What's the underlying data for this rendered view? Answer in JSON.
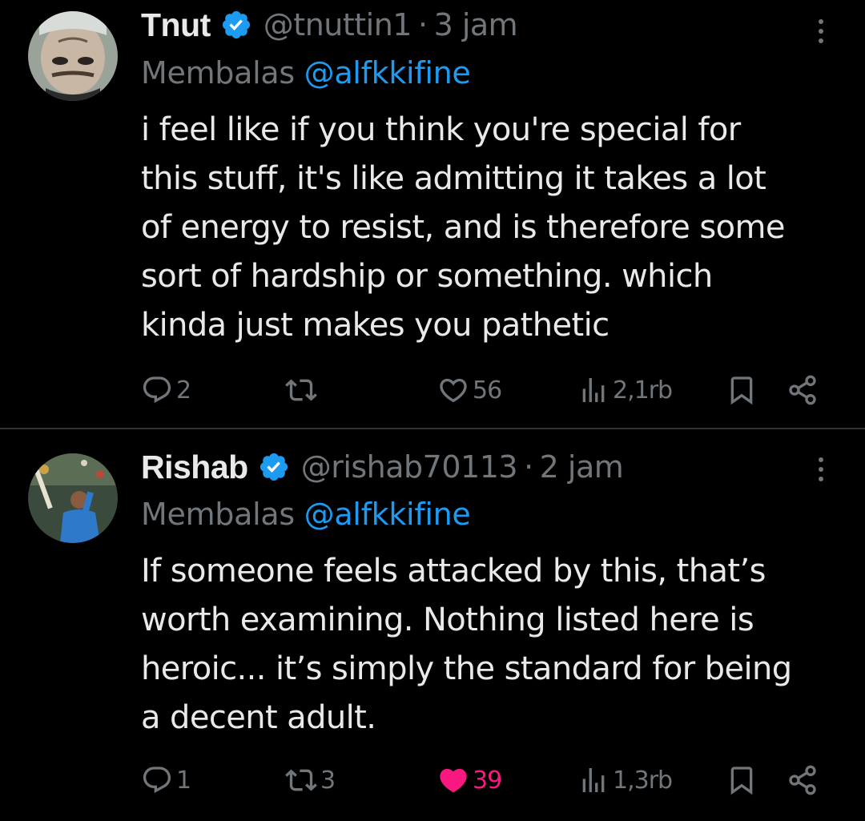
{
  "colors": {
    "background": "#000000",
    "text": "#e7e9ea",
    "muted": "#71767b",
    "link": "#1d9bf0",
    "verified": "#1d9bf0",
    "like_active": "#f91880",
    "divider": "#2f3336"
  },
  "tweets": [
    {
      "display_name": "Tnut",
      "verified": true,
      "handle": "@tnuttin1",
      "separator": "·",
      "time": "3 jam",
      "reply_prefix": "Membalas",
      "reply_to": "@alfkkifine",
      "lines": [
        "i feel like if you think you're special for",
        "this stuff, it's like admitting it takes a lot",
        "of energy to resist, and is therefore some",
        "sort of hardship or something. which",
        "kinda just makes you pathetic"
      ],
      "actions": {
        "replies": "2",
        "retweets": "",
        "likes": "56",
        "liked": false,
        "views": "2,1rb"
      },
      "icons": [
        "reply-icon",
        "retweet-icon",
        "heart-icon",
        "views-icon",
        "bookmark-icon",
        "share-icon",
        "more-icon",
        "verified-badge-icon"
      ]
    },
    {
      "display_name": "Rishab",
      "verified": true,
      "handle": "@rishab70113",
      "separator": "·",
      "time": "2 jam",
      "reply_prefix": "Membalas",
      "reply_to": "@alfkkifine",
      "lines": [
        "If someone feels attacked by this, that’s",
        "worth examining. Nothing listed here is",
        "heroic... it’s simply the standard for being",
        "a decent adult."
      ],
      "actions": {
        "replies": "1",
        "retweets": "3",
        "likes": "39",
        "liked": true,
        "views": "1,3rb"
      },
      "icons": [
        "reply-icon",
        "retweet-icon",
        "heart-filled-icon",
        "views-icon",
        "bookmark-icon",
        "share-icon",
        "more-icon",
        "verified-badge-icon"
      ]
    }
  ]
}
